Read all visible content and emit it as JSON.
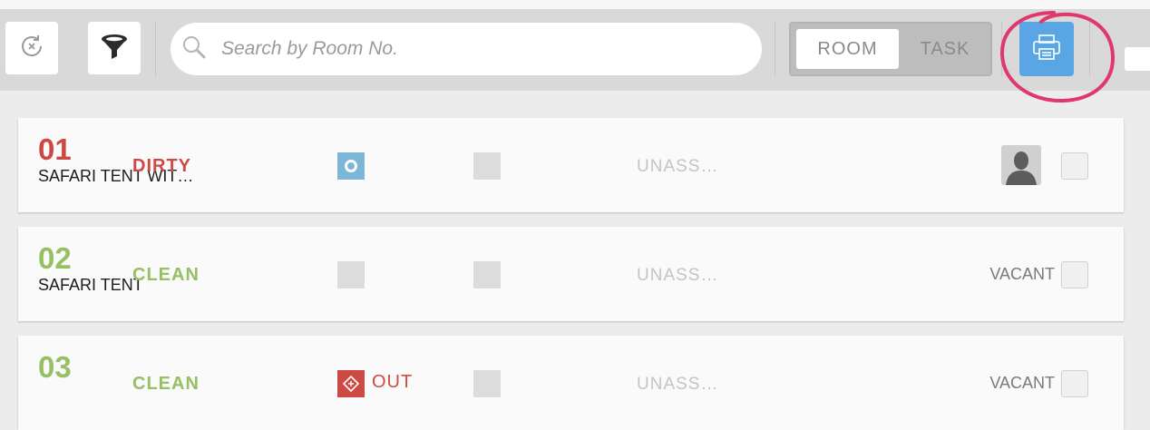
{
  "toolbar": {
    "refresh_icon": "refresh-icon",
    "filter_icon": "funnel-icon",
    "search": {
      "placeholder": "Search by Room No.",
      "value": ""
    },
    "view_toggle": {
      "room_label": "ROOM",
      "task_label": "TASK",
      "selected": "ROOM"
    },
    "print_icon": "printer-icon",
    "accent_color": "#5aa6e4",
    "highlight_color": "#e0386e"
  },
  "rooms": [
    {
      "number": "01",
      "type": "SAFARI TENT WIT…",
      "status": "DIRTY",
      "status_color": "#cd4a44",
      "assignee": "UNASS…",
      "indicator": "ring",
      "right": "avatar"
    },
    {
      "number": "02",
      "type": "SAFARI TENT",
      "status": "CLEAN",
      "status_color": "#97bf63",
      "assignee": "UNASS…",
      "indicator": "none",
      "right": "VACANT"
    },
    {
      "number": "03",
      "type": "",
      "status": "CLEAN",
      "status_color": "#97bf63",
      "assignee": "UNASS…",
      "indicator": "OUT",
      "right": "VACANT"
    }
  ]
}
